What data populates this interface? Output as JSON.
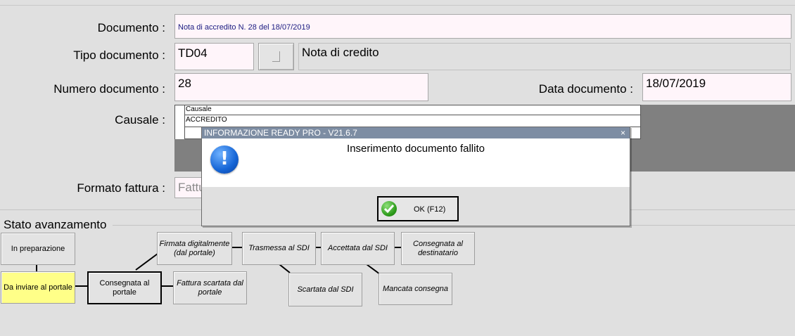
{
  "form": {
    "documento_label": "Documento :",
    "documento_value": "Nota di accredito N. 28 del 18/07/2019",
    "tipo_label": "Tipo documento :",
    "tipo_code": "TD04",
    "tipo_desc": "Nota di credito",
    "numero_label": "Numero documento :",
    "numero_value": "28",
    "data_label": "Data documento :",
    "data_value": "18/07/2019",
    "causale_label": "Causale :",
    "causale_header": "Causale",
    "causale_row": "ACCREDITO",
    "formato_label": "Formato fattura :",
    "formato_value": "Fattu"
  },
  "workflow": {
    "section_title": "Stato avanzamento",
    "steps": {
      "in_preparazione": "In preparazione",
      "da_inviare": "Da inviare al portale",
      "consegnata_portale": "Consegnata al portale",
      "firmata": "Firmata digitalmente (dal portale)",
      "fattura_scartata": "Fattura scartata dal portale",
      "trasmessa": "Trasmessa al SDI",
      "scartata_sdi": "Scartata dal SDI",
      "accettata": "Accettata dal SDI",
      "mancata": "Mancata consegna",
      "consegnata_dest": "Consegnata al destinatario"
    }
  },
  "dialog": {
    "title": "INFORMAZIONE READY PRO - V21.6.7",
    "close": "×",
    "message": "Inserimento documento fallito",
    "ok_label": "OK (F12)",
    "icon": "exclamation-icon"
  },
  "colors": {
    "field_bg": "#fff5fa",
    "title_bar": "#7d8da3",
    "highlight_step": "#ffff88"
  }
}
